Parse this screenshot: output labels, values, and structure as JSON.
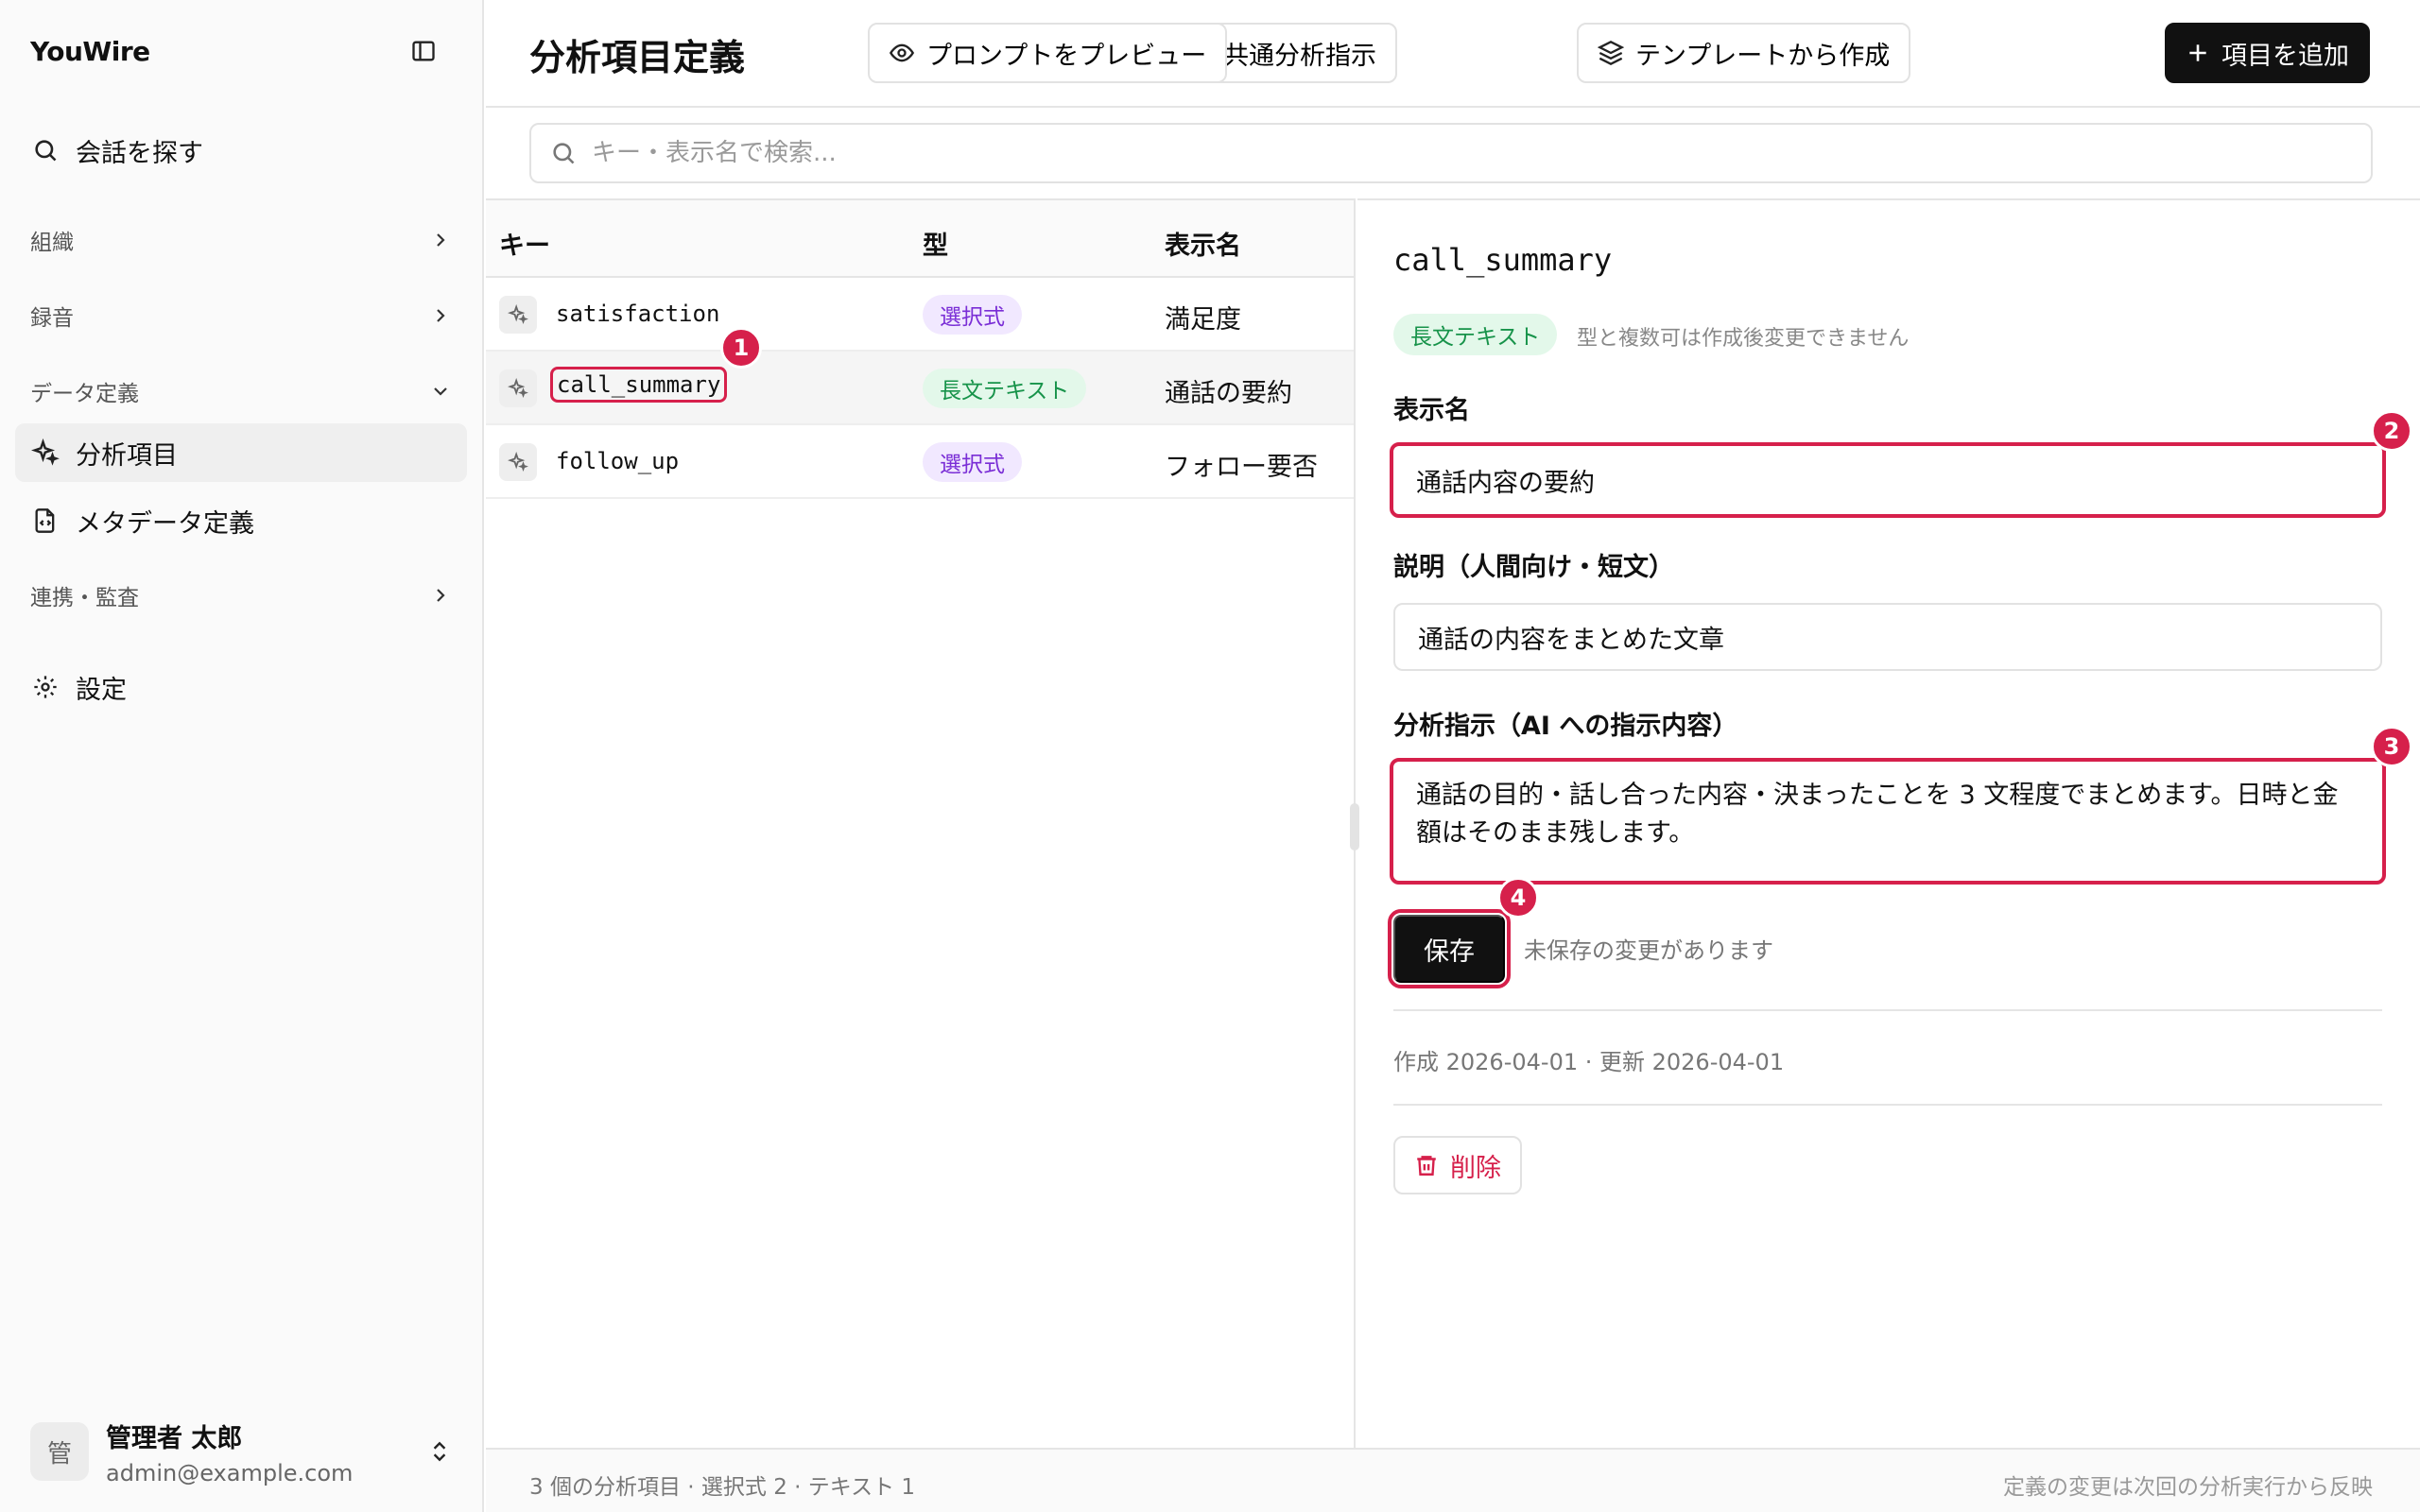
{
  "sidebar": {
    "brand": "YouWire",
    "search_label": "会話を探す",
    "groups": {
      "org": "組織",
      "recording": "録音",
      "data_def": "データ定義",
      "integration": "連携・監査"
    },
    "items": {
      "analysis": "分析項目",
      "metadata": "メタデータ定義",
      "settings": "設定"
    },
    "user": {
      "avatar": "管",
      "name": "管理者 太郎",
      "email": "admin@example.com"
    }
  },
  "header": {
    "title": "分析項目定義",
    "btn_common": "共通分析指示",
    "btn_preview": "プロンプトをプレビュー",
    "btn_template": "テンプレートから作成",
    "btn_add": "項目を追加"
  },
  "search": {
    "placeholder": "キー・表示名で検索..."
  },
  "table": {
    "headers": {
      "key": "キー",
      "type": "型",
      "label": "表示名"
    },
    "rows": [
      {
        "key": "satisfaction",
        "type": "選択式",
        "label": "満足度"
      },
      {
        "key": "call_summary",
        "type": "長文テキスト",
        "label": "通話の要約"
      },
      {
        "key": "follow_up",
        "type": "選択式",
        "label": "フォロー要否"
      }
    ]
  },
  "detail": {
    "key": "call_summary",
    "type_badge": "長文テキスト",
    "type_note": "型と複数可は作成後変更できません",
    "display_label": "表示名",
    "display_value": "通話内容の要約",
    "desc_label": "説明（人間向け・短文）",
    "desc_value": "通話の内容をまとめた文章",
    "instr_label": "分析指示（AI への指示内容）",
    "instr_value": "通話の目的・話し合った内容・決まったことを 3 文程度でまとめます。日時と金額はそのまま残します。",
    "save": "保存",
    "unsaved": "未保存の変更があります",
    "meta": "作成 2026-04-01 · 更新 2026-04-01",
    "delete": "削除"
  },
  "markers": [
    "1",
    "2",
    "3",
    "4"
  ],
  "footer": {
    "summary": "3 個の分析項目 · 選択式 2 · テキスト 1",
    "note": "定義の変更は次回の分析実行から反映"
  },
  "colors": {
    "accent": "#d6204b",
    "primary": "#111111",
    "select_badge": "#7a2ed6",
    "text_badge": "#17934a"
  }
}
